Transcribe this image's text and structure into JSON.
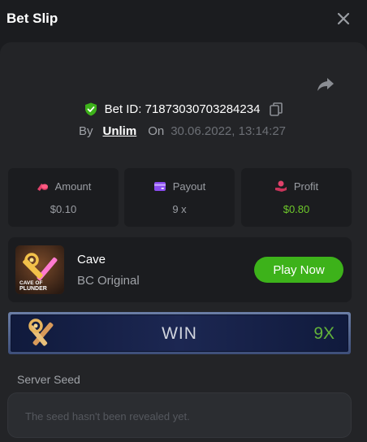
{
  "header": {
    "title": "Bet Slip",
    "close_icon": "close-icon"
  },
  "bet": {
    "id_text": "Bet ID: 71873030703284234",
    "by_label": "By",
    "user": "Unlim",
    "on_label": "On",
    "timestamp": "30.06.2022, 13:14:27"
  },
  "stats": {
    "amount": {
      "label": "Amount",
      "value": "$0.10",
      "icon": "coins-icon"
    },
    "payout": {
      "label": "Payout",
      "value": "9 x",
      "icon": "wallet-icon"
    },
    "profit": {
      "label": "Profit",
      "value": "$0.80",
      "icon": "hand-coins-icon"
    }
  },
  "game": {
    "name": "Cave",
    "provider": "BC Original",
    "play_label": "Play Now",
    "thumb_caption_line1": "CAVE OF",
    "thumb_caption_line2": "PLUNDER"
  },
  "result": {
    "label": "WIN",
    "multiplier": "9X"
  },
  "seed": {
    "label": "Server Seed",
    "value": "The seed hasn't been revealed yet."
  },
  "colors": {
    "accent_green": "#3db21a",
    "profit_green": "#6ec82b",
    "background": "#1b1c1f",
    "panel": "#232427"
  }
}
